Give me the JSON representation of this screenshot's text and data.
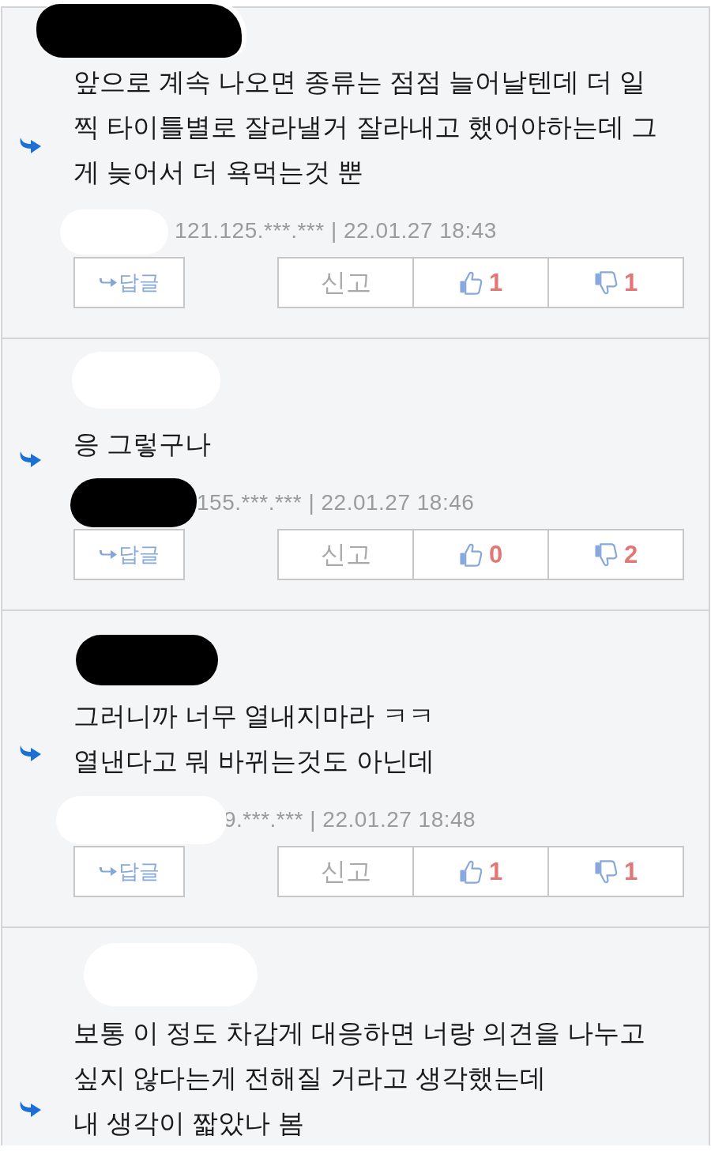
{
  "comments": [
    {
      "name_redaction": {
        "kind": "black"
      },
      "lines": [
        "앞으로 계속 나오면 종류는 점점 늘어날텐데 더 일",
        "찍 타이틀별로 잘라낼거 잘라내고 했어야하는데 그",
        "게 늦어서 더 욕먹는것 뿐"
      ],
      "meta_redaction": {
        "kind": "white"
      },
      "meta": "121.125.***.*** | 22.01.27 18:43",
      "actions": {
        "reply": "답글",
        "report": "신고",
        "likes": "1",
        "dislikes": "1"
      }
    },
    {
      "name_redaction": {
        "kind": "white"
      },
      "lines": [
        "응 그렇구나"
      ],
      "meta_redaction": {
        "kind": "black"
      },
      "meta": "155.***.*** | 22.01.27 18:46",
      "actions": {
        "reply": "답글",
        "report": "신고",
        "likes": "0",
        "dislikes": "2"
      }
    },
    {
      "name_redaction": {
        "kind": "black"
      },
      "lines": [
        "그러니까 너무 열내지마라 ㅋㅋ",
        "열낸다고 뭐 바뀌는것도 아닌데"
      ],
      "meta_redaction": {
        "kind": "white"
      },
      "meta": "9.***.*** | 22.01.27 18:48",
      "actions": {
        "reply": "답글",
        "report": "신고",
        "likes": "1",
        "dislikes": "1"
      }
    },
    {
      "name_redaction": {
        "kind": "white"
      },
      "lines": [
        "보통 이 정도 차갑게 대응하면 너랑 의견을 나누고",
        "싶지 않다는게 전해질 거라고 생각했는데",
        "내 생각이 짧았나 봄"
      ]
    }
  ]
}
